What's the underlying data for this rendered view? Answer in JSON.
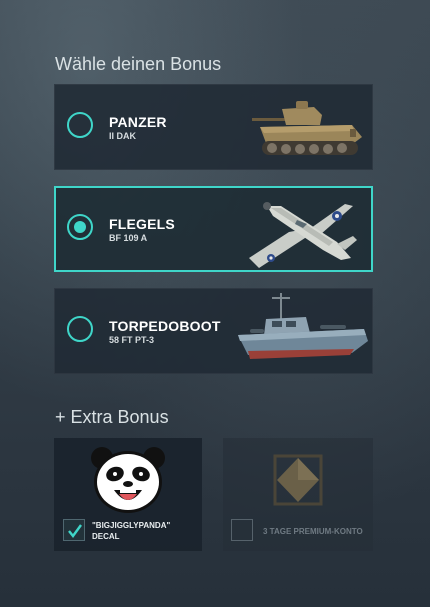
{
  "headings": {
    "choose": "Wähle deinen Bonus",
    "extra": "+ Extra Bonus"
  },
  "options": [
    {
      "name": "PANZER",
      "sub": "II DAK",
      "selected": false,
      "icon": "tank-image"
    },
    {
      "name": "FLEGELS",
      "sub": "BF 109 A",
      "selected": true,
      "icon": "plane-image"
    },
    {
      "name": "TORPEDOBOOT",
      "sub": "58 FT PT-3",
      "selected": false,
      "icon": "boat-image"
    }
  ],
  "extras": [
    {
      "label_line1": "\"BIGJIGGLYPANDA\"",
      "label_line2": "DECAL",
      "checked": true,
      "icon": "panda-decal-icon"
    },
    {
      "label": "3 TAGE PREMIUM-KONTO",
      "checked": false,
      "icon": "premium-diamond-icon"
    }
  ],
  "colors": {
    "accent": "#3fd6c9",
    "card": "#202a34"
  }
}
